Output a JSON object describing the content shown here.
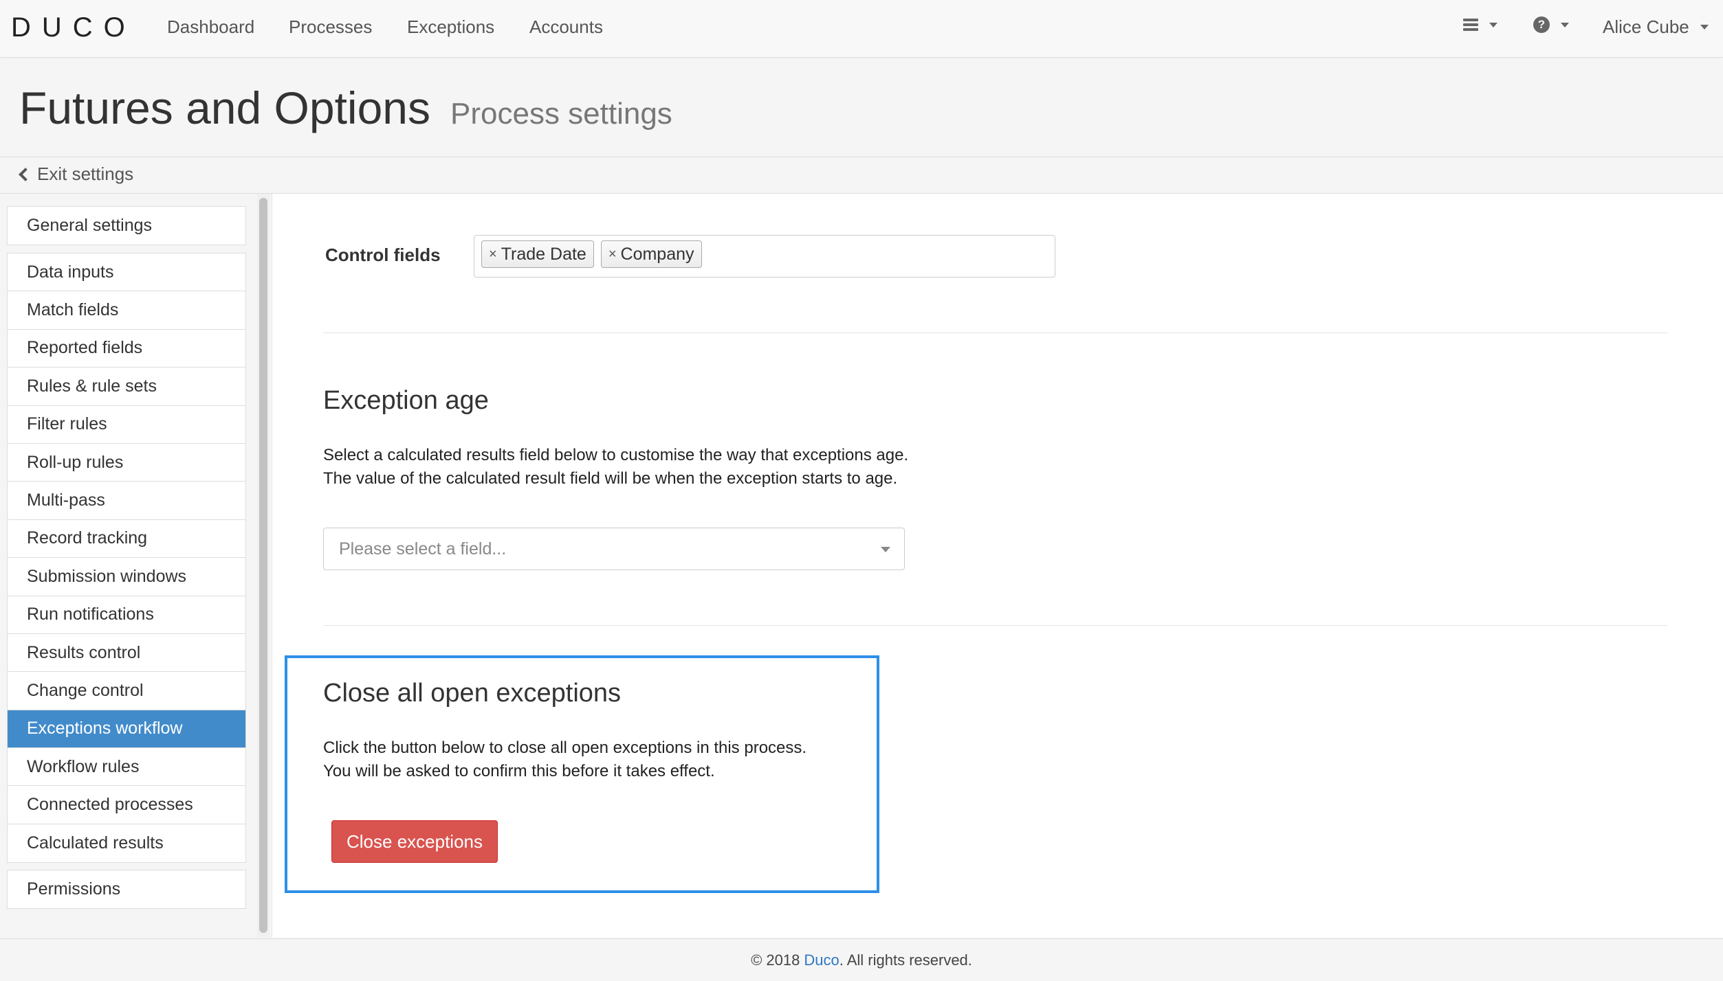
{
  "app": {
    "logo": "DUCO"
  },
  "nav": {
    "links": [
      "Dashboard",
      "Processes",
      "Exceptions",
      "Accounts"
    ],
    "user": "Alice Cube",
    "menu_icon": "hamburger-icon",
    "help_icon": "help-icon"
  },
  "header": {
    "title": "Futures and Options",
    "subtitle": "Process settings"
  },
  "exit": {
    "label": "Exit settings"
  },
  "sidebar": {
    "top": [
      "General settings"
    ],
    "items": [
      "Data inputs",
      "Match fields",
      "Reported fields",
      "Rules & rule sets",
      "Filter rules",
      "Roll-up rules",
      "Multi-pass",
      "Record tracking",
      "Submission windows",
      "Run notifications",
      "Results control",
      "Change control",
      "Exceptions workflow",
      "Workflow rules",
      "Connected processes",
      "Calculated results"
    ],
    "active": "Exceptions workflow",
    "bottom": [
      "Permissions"
    ]
  },
  "control_fields": {
    "label": "Control fields",
    "tags": [
      "Trade Date",
      "Company"
    ]
  },
  "exception_age": {
    "heading": "Exception age",
    "line1": "Select a calculated results field below to customise the way that exceptions age.",
    "line2": "The value of the calculated result field will be when the exception starts to age.",
    "placeholder": "Please select a field..."
  },
  "close_exceptions": {
    "heading": "Close all open exceptions",
    "line1": "Click the button below to close all open exceptions in this process.",
    "line2": "You will be asked to confirm this before it takes effect.",
    "button": "Close exceptions"
  },
  "footer": {
    "prefix": "© 2018",
    "link": "Duco",
    "suffix": ". All rights reserved."
  },
  "colors": {
    "accent": "#428bca",
    "danger": "#d9534f",
    "highlight": "#2e8fe8",
    "link": "#2f78c4"
  }
}
